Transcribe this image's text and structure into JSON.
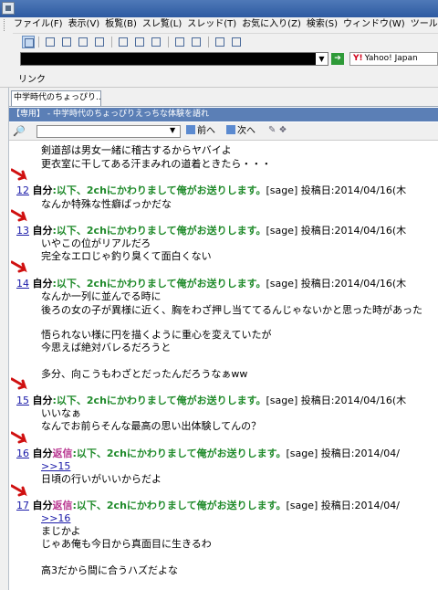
{
  "menu": {
    "items": [
      "ファイル(F)",
      "表示(V)",
      "板覧(B)",
      "スレ覧(L)",
      "スレッド(T)",
      "お気に入り(Z)",
      "検索(S)",
      "ウィンドウ(W)",
      "ツール(O)"
    ],
    "overflow": "ヘ"
  },
  "search": {
    "engine": "Yahoo! Japan"
  },
  "links": {
    "label": "リンク"
  },
  "tab": {
    "label": "中学時代のちょっぴり..."
  },
  "thread": {
    "title": "【専用】 - 中学時代のちょっぴりえっちな体験を語れ"
  },
  "find": {
    "prev_label": "前へ",
    "next_label": "次へ"
  },
  "posts": [
    {
      "lines": [
        "剣道部は男女一緒に稽古するからヤバイよ",
        "更衣室に干してある汗まみれの道着ときたら・・・"
      ]
    },
    {
      "number": "12",
      "self": "自分",
      "reply": "",
      "name": ":以下、2chにかわりまして俺がお送りします。",
      "meta": "[sage] 投稿日:2014/04/16(木",
      "anchor": "",
      "lines": [
        "なんか特殊な性癖ばっかだな"
      ]
    },
    {
      "number": "13",
      "self": "自分",
      "reply": "",
      "name": ":以下、2chにかわりまして俺がお送りします。",
      "meta": "[sage] 投稿日:2014/04/16(木",
      "anchor": "",
      "lines": [
        "いやこの位がリアルだろ",
        "完全なエロじゃ釣り臭くて面白くない"
      ]
    },
    {
      "number": "14",
      "self": "自分",
      "reply": "",
      "name": ":以下、2chにかわりまして俺がお送りします。",
      "meta": "[sage] 投稿日:2014/04/16(木",
      "anchor": "",
      "lines": [
        "なんか一列に並んでる時に",
        "後ろの女の子が異様に近く、胸をわざ押し当ててるんじゃないかと思った時があった",
        "",
        "悟られない様に円を描くように重心を変えていたが",
        "今思えば絶対バレるだろうと",
        "",
        "多分、向こうもわざとだったんだろうなぁww"
      ]
    },
    {
      "number": "15",
      "self": "自分",
      "reply": "",
      "name": ":以下、2chにかわりまして俺がお送りします。",
      "meta": "[sage] 投稿日:2014/04/16(木",
      "anchor": "",
      "lines": [
        "いいなぁ",
        "なんでお前らそんな最高の思い出体験してんの？"
      ]
    },
    {
      "number": "16",
      "self": "自分",
      "reply": "返信",
      "name": ":以下、2chにかわりまして俺がお送りします。",
      "meta": "[sage] 投稿日:2014/04/",
      "anchor": ">>15",
      "lines": [
        "日頃の行いがいいからだよ"
      ]
    },
    {
      "number": "17",
      "self": "自分",
      "reply": "返信",
      "name": ":以下、2chにかわりまして俺がお送りします。",
      "meta": "[sage] 投稿日:2014/04/",
      "anchor": ">>16",
      "lines": [
        "まじかよ",
        "じゃあ俺も今日から真面目に生きるわ",
        "",
        "高3だから間に合うハズだよな"
      ]
    }
  ]
}
